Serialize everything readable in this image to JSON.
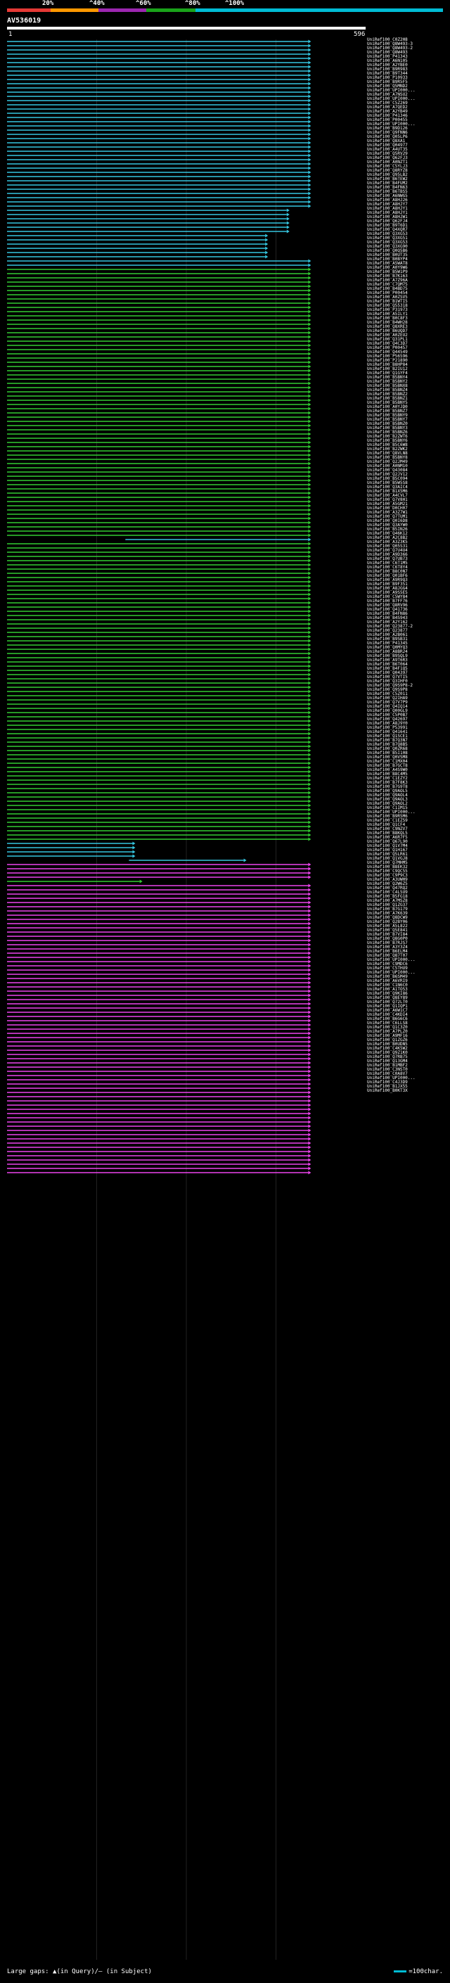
{
  "chart_data": {
    "type": "bar",
    "title": "AV536019",
    "query_start": "1",
    "query_end": "596",
    "scale_labels": [
      "20%",
      "^40%",
      "^60%",
      "^80%",
      "^100%"
    ],
    "scale_colors": [
      "#e53935",
      "#ff9800",
      "#9c27b0",
      "#1aa31a",
      "#00bcd4"
    ],
    "footer_left": "Large gaps: ▲(in Query)/– (in Subject)",
    "footer_right": "=100char.",
    "groups": [
      {
        "color": "#35c6e0",
        "start": 0.0,
        "end": 0.84,
        "count": 40
      },
      {
        "color": "#35c6e0",
        "start": 0.0,
        "end": 0.78,
        "count": 6
      },
      {
        "color": "#35c6e0",
        "start": 0.0,
        "end": 0.72,
        "count": 6
      },
      {
        "color": "#35c6e0",
        "start": 0.0,
        "end": 0.84,
        "count": 2
      },
      {
        "color": "#33cc33",
        "start": 0.0,
        "end": 0.84,
        "count": 64
      },
      {
        "color": "#35c6e0",
        "start": 0.33,
        "end": 0.84,
        "count": 1
      },
      {
        "color": "#33cc33",
        "start": 0.0,
        "end": 0.84,
        "count": 71
      },
      {
        "color": "#35c6e0",
        "start": 0.0,
        "end": 0.35,
        "count": 4
      },
      {
        "color": "#35c6e0",
        "start": 0.34,
        "end": 0.66,
        "count": 1
      },
      {
        "color": "#ee44ee",
        "start": 0.0,
        "end": 0.84,
        "count": 4
      },
      {
        "color": "#33cc33",
        "start": 0.0,
        "end": 0.37,
        "count": 1
      },
      {
        "color": "#ee44ee",
        "start": 0.0,
        "end": 0.84,
        "count": 69
      }
    ],
    "labels": [
      "UniRef100_C0Z2H8",
      "UniRef100_Q8W493-3",
      "UniRef100_Q8W493-2",
      "UniRef100_Q8W493",
      "UniRef100_P41343",
      "UniRef100_A6N105",
      "UniRef100_A2YBE0",
      "UniRef100_B9R983",
      "UniRef100_B9T344",
      "UniRef100_P10933",
      "UniRef100_B9R5F5",
      "UniRef100_Q5MND2",
      "UniRef100_UPI000...",
      "UniRef100_A7NSU2",
      "UniRef100_UPI000...",
      "UniRef100_C5Z269",
      "UniRef100_A7QED2",
      "UniRef100_A2YB49",
      "UniRef100_P41346",
      "UniRef100_P00455",
      "UniRef100_UPI000...",
      "UniRef100_B9D126",
      "UniRef100_Q9FNN6",
      "UniRef100_Q05LP6",
      "UniRef100_Q8XA1",
      "UniRef100_Q04977",
      "UniRef100_A4UT35",
      "UniRef100_Q5RV29",
      "UniRef100_Q62FJ3",
      "UniRef100_A0NZT1",
      "UniRef100_C5YLJ3",
      "UniRef100_Q8RYZ8",
      "UniRef100_Q95LB2",
      "UniRef100_B6TEW2",
      "UniRef100_B4FUM2",
      "UniRef100_B4FN63",
      "UniRef100_B6TBS5",
      "UniRef100_A6NWG5",
      "UniRef100_A8HJ26",
      "UniRef100_A8HJY7",
      "UniRef100_A8HJY1",
      "UniRef100_A8HJY1",
      "UniRef100_A8HJW1",
      "UniRef100_Q62FJ4",
      "UniRef100_B9T6D1",
      "UniRef100_Q4XQR7",
      "UniRef100_Q3XG53",
      "UniRef100_Q3XG51",
      "UniRef100_Q3XG53",
      "UniRef100_Q3XG90",
      "UniRef100_Q0Q5B6",
      "UniRef100_B0UT35",
      "UniRef100_B0BYP4",
      "UniRef100_A5WAT8",
      "UniRef100_A0Y9W6",
      "UniRef100_B5W1P9",
      "UniRef100_B7K163",
      "UniRef100_A7Z96A",
      "UniRef100_C7QM75",
      "UniRef100_B4BD75",
      "UniRef100_P00454",
      "UniRef100_A0ZSV5",
      "UniRef100_B1WTI5",
      "UniRef100_Q55318",
      "UniRef100_P31973",
      "UniRef100_A5ILY1",
      "UniRef100_B0C8F3",
      "UniRef100_B4WH28",
      "UniRef100_Q8XRE3",
      "UniRef100_B6UQD7",
      "UniRef100_A0ZEU2",
      "UniRef100_Q31PL1",
      "UniRef100_Q4C3D7",
      "UniRef100_P00457",
      "UniRef100_Q44549",
      "UniRef100_P56596",
      "UniRef100_P21890",
      "UniRef100_B8HP84",
      "UniRef100_B2IU12",
      "UniRef100_Q1GYF4",
      "UniRef100_B5BNY4",
      "UniRef100_B5BNY2",
      "UniRef100_B5BNX8",
      "UniRef100_B5BNZ4",
      "UniRef100_B5BNZ2",
      "UniRef100_B5BNZ1",
      "UniRef100_B5BNY5",
      "UniRef100_A0YJD0",
      "UniRef100_B5BNZ7",
      "UniRef100_B5BNY9",
      "UniRef100_B5BNY7",
      "UniRef100_B5BNZ0",
      "UniRef100_B5BNY3",
      "UniRef100_B5BNZ6",
      "UniRef100_B2ZWT6",
      "UniRef100_B5BNY6",
      "UniRef100_B5C6W8",
      "UniRef100_B2ZWK2",
      "UniRef100_Q8VLN8",
      "UniRef100_B5BNY8",
      "UniRef100_Q2JM49",
      "UniRef100_A0NM10",
      "UniRef100_Q43084",
      "UniRef100_Q2JV12",
      "UniRef100_B5C094",
      "UniRef100_B5W5S8",
      "UniRef100_Q3AIC4",
      "UniRef100_B1X5M6",
      "UniRef100_A4CVL7",
      "UniRef100_Q7V8H1",
      "UniRef100_A5GM21",
      "UniRef100_D0CH07",
      "UniRef100_A3Z7W1",
      "UniRef100_Q7TUM1",
      "UniRef100_Q0I6D8",
      "UniRef100_Q3AYW0",
      "UniRef100_B5IN26",
      "UniRef100_Q46K12",
      "UniRef100_A2C8B2",
      "UniRef100_A3Z3K5",
      "UniRef100_Q05S31",
      "UniRef100_Q7U4U4",
      "UniRef100_A9D366",
      "UniRef100_Q7UB73",
      "UniRef100_C6T1M5",
      "UniRef100_C6T8Y4",
      "UniRef100_B8C0N7",
      "UniRef100_Q01BF6",
      "UniRef100_A9R9Q3",
      "UniRef100_B9F351",
      "UniRef100_A8JGG4",
      "UniRef100_A9S5E5",
      "UniRef100_C5WY84",
      "UniRef100_B7FF76",
      "UniRef100_Q8RV96",
      "UniRef100_Q41736",
      "UniRef100_B4FN86",
      "UniRef100_B4S943",
      "UniRef100_A2Y162",
      "UniRef100_Q23877-2",
      "UniRef100_Q23877",
      "UniRef100_A2B061",
      "UniRef100_B9SB31",
      "UniRef100_P41345",
      "UniRef100_Q0MYQ3",
      "UniRef100_A8BR24",
      "UniRef100_B9SQL9",
      "UniRef100_A9T6R3",
      "UniRef100_B6T064",
      "UniRef100_B4F1Q5",
      "UniRef100_Q04397",
      "UniRef100_Q7VTI5",
      "UniRef100_Q3IHF0",
      "UniRef100_Q9S9P8-2",
      "UniRef100_Q9S9P8",
      "UniRef100_C5Z011",
      "UniRef100_Q2IHA9",
      "UniRef100_Q7V7P9",
      "UniRef100_Q4IQ14",
      "UniRef100_Q00GL9",
      "UniRef100_C5P0B7",
      "UniRef100_Q42697",
      "UniRef100_A8J9Y0",
      "UniRef100_P53991",
      "UniRef100_Q41641",
      "UniRef100_Q1SCE1",
      "UniRef100_B7Q3N7",
      "UniRef100_B7Q8B5",
      "UniRef100_Q0ZR68",
      "UniRef100_B5I108",
      "UniRef100_Q0VSM8",
      "UniRef100_C1MX04",
      "UniRef100_B7GCT8",
      "UniRef100_A4S9W0",
      "UniRef100_B8C4M5",
      "UniRef100_C1EZY2",
      "UniRef100_B7F8K3",
      "UniRef100_B7G9T8",
      "UniRef100_Q9AOL5",
      "UniRef100_Q9AOL4",
      "UniRef100_Q9AOL3",
      "UniRef100_Q9AOL2",
      "UniRef100_C1IM15",
      "UniRef100_UPI000...",
      "UniRef100_B9R5M6",
      "UniRef100_C1EZ59",
      "UniRef100_Q1CF4",
      "UniRef100_C9NZV7",
      "UniRef100_B8KQL5",
      "UniRef100_A6R7F5",
      "UniRef100_Q67L90",
      "UniRef100_Q1V7M4",
      "UniRef100_Q1H167",
      "UniRef100_Q5LR61",
      "UniRef100_Q1VGJ8",
      "UniRef100_Q7MHM5",
      "UniRef100_B8EK32",
      "UniRef100_C9QC55",
      "UniRef100_C9P9C3",
      "UniRef100_A3UWH9",
      "UniRef100_Q2W6Z5",
      "UniRef100_Q47RQ2",
      "UniRef100_C4L5U9",
      "UniRef100_B5FG18",
      "UniRef100_A7MSZ8",
      "UniRef100_Q1ZG37",
      "UniRef100_B7G179",
      "UniRef100_A7K639",
      "UniRef100_Q8DCW9",
      "UniRef100_Q2BY06",
      "UniRef100_A5L822",
      "UniRef100_Q5E841",
      "UniRef100_B7VI84",
      "UniRef100_Q8G0P0",
      "UniRef100_B7RJS7",
      "UniRef100_A3Y3Z4",
      "UniRef100_B6ELM4",
      "UniRef100_Q87T07",
      "UniRef100_UPI000...",
      "UniRef100_C9MDC6",
      "UniRef100_C5THU9",
      "UniRef100_UPI000...",
      "UniRef100_B6SM49",
      "UniRef100_A6VRI9",
      "UniRef100_C1N6C0",
      "UniRef100_A1TO53",
      "UniRef100_Q9KI86",
      "UniRef100_Q8EY89",
      "UniRef100_Q72LT0",
      "UniRef100_Q1IQP1",
      "UniRef100_A6W1C7",
      "UniRef100_C4KDI4",
      "UniRef100_B6G6C6",
      "UniRef100_C6LLS8",
      "UniRef100_Q1C3Z0",
      "UniRef100_A7PLZ0",
      "UniRef100_A9MF16",
      "UniRef100_Q1ZGZ6",
      "UniRef100_B0UDN5",
      "UniRef100_C4K5W2",
      "UniRef100_Q9Z1K0",
      "UniRef100_Q7RB75",
      "UniRef100_Q13GM4",
      "UniRef100_B1MBF2",
      "UniRef100_C3NST0",
      "UniRef100_C0A8V7",
      "UniRef100_UPI000...",
      "UniRef100_C4J3D9",
      "UniRef100_B1JX55",
      "UniRef100_B0KT3X"
    ]
  }
}
